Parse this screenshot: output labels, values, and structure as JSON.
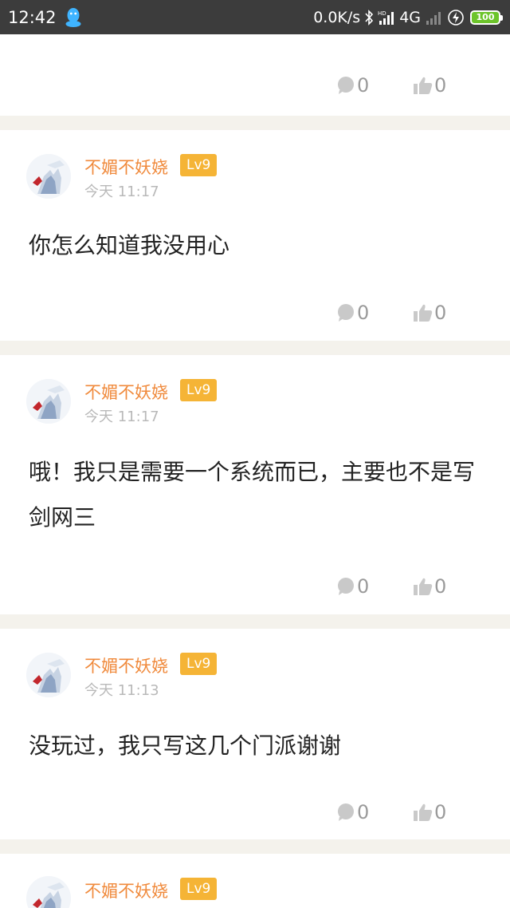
{
  "status_bar": {
    "time": "12:42",
    "network_speed": "0.0K/s",
    "network_type": "4G",
    "battery": "100",
    "icons": [
      "qq-penguin-icon",
      "bluetooth-icon",
      "hd-signal-icon",
      "no-signal-icon",
      "charging-icon",
      "battery-icon"
    ]
  },
  "top_card": {
    "comment_count": "0",
    "like_count": "0"
  },
  "comments": [
    {
      "username": "不媚不妖娆",
      "level": "Lv9",
      "time": "今天 11:17",
      "text": "你怎么知道我没用心",
      "comment_count": "0",
      "like_count": "0"
    },
    {
      "username": "不媚不妖娆",
      "level": "Lv9",
      "time": "今天 11:17",
      "text": "哦！我只是需要一个系统而已，主要也不是写剑网三",
      "comment_count": "0",
      "like_count": "0"
    },
    {
      "username": "不媚不妖娆",
      "level": "Lv9",
      "time": "今天 11:13",
      "text": "没玩过，我只写这几个门派谢谢",
      "comment_count": "0",
      "like_count": "0"
    },
    {
      "username": "不媚不妖娆",
      "level": "Lv9"
    }
  ],
  "colors": {
    "username": "#f08a3c",
    "level_badge": "#f5b436",
    "timestamp": "#b9b9b9",
    "action": "#9a9a9a",
    "separator": "#f4f2ec",
    "status_bar": "#3c3c3c"
  }
}
